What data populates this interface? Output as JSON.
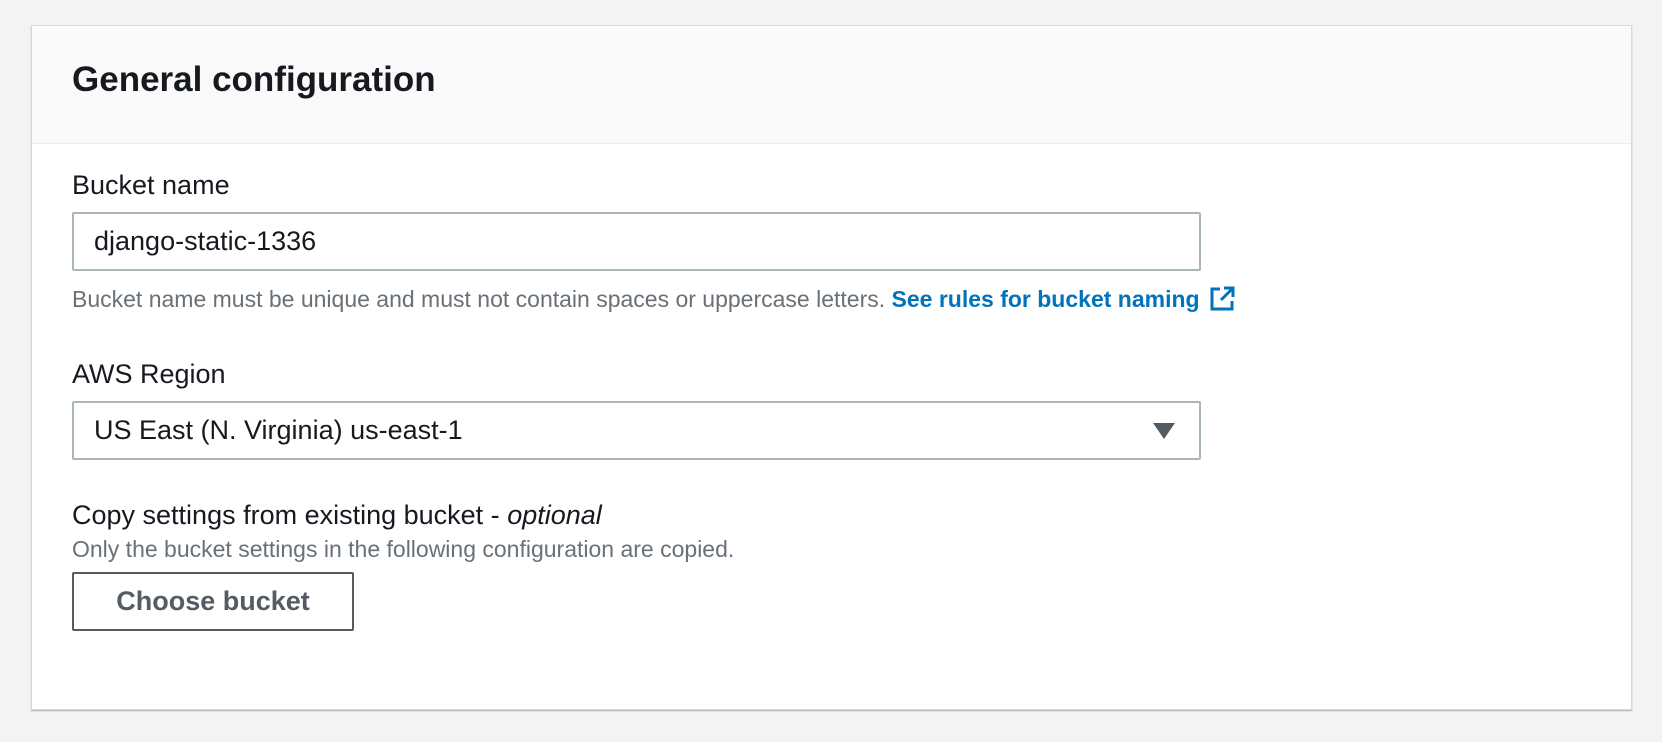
{
  "panel": {
    "title": "General configuration"
  },
  "bucket_name": {
    "label": "Bucket name",
    "value": "django-static-1336",
    "hint": "Bucket name must be unique and must not contain spaces or uppercase letters.",
    "link_label": "See rules for bucket naming",
    "link_icon": "external-link-icon"
  },
  "region": {
    "label": "AWS Region",
    "selected": "US East (N. Virginia) us-east-1",
    "dropdown_icon": "caret-down-icon"
  },
  "copy_settings": {
    "label": "Copy settings from existing bucket - ",
    "label_optional": "optional",
    "description": "Only the bucket settings in the following configuration are copied.",
    "button_label": "Choose bucket"
  },
  "colors": {
    "link": "#0073bb",
    "border": "#aab7b8",
    "hint_text": "#687078",
    "button_border": "#545b64",
    "page_background": "#f2f3f3"
  }
}
